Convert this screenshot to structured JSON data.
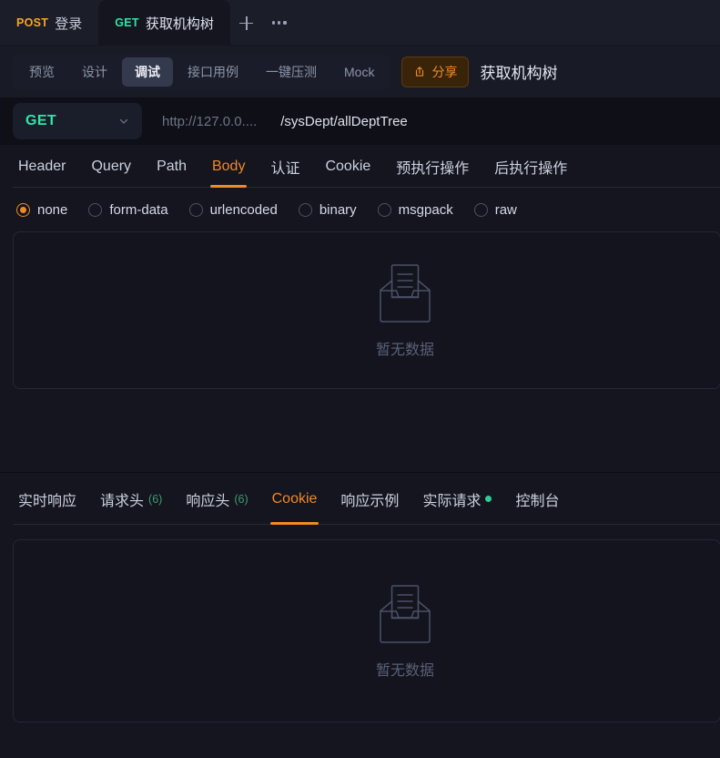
{
  "window_tabs": [
    {
      "verb": "POST",
      "verb_class": "post",
      "label": "登录",
      "active": false
    },
    {
      "verb": "GET",
      "verb_class": "get",
      "label": "获取机构树",
      "active": true
    }
  ],
  "window_actions": {
    "new_tab_icon": "plus-icon",
    "more_icon": "ellipsis-icon"
  },
  "toolbar": {
    "segments": [
      {
        "label": "预览",
        "active": false
      },
      {
        "label": "设计",
        "active": false
      },
      {
        "label": "调试",
        "active": true
      },
      {
        "label": "接口用例",
        "active": false
      },
      {
        "label": "一键压测",
        "active": false
      },
      {
        "label": "Mock",
        "active": false
      }
    ],
    "share_label": "分享",
    "share_icon": "share-export-icon",
    "request_title": "获取机构树"
  },
  "urlbar": {
    "method": "GET",
    "method_caret_icon": "chevron-down-icon",
    "host_placeholder": "http://127.0.0....",
    "path": "/sysDept/allDeptTree"
  },
  "request_tabs": [
    {
      "label": "Header",
      "active": false
    },
    {
      "label": "Query",
      "active": false
    },
    {
      "label": "Path",
      "active": false
    },
    {
      "label": "Body",
      "active": true
    },
    {
      "label": "认证",
      "active": false
    },
    {
      "label": "Cookie",
      "active": false
    },
    {
      "label": "预执行操作",
      "active": false
    },
    {
      "label": "后执行操作",
      "active": false
    }
  ],
  "body_types": [
    {
      "label": "none",
      "selected": true
    },
    {
      "label": "form-data",
      "selected": false
    },
    {
      "label": "urlencoded",
      "selected": false
    },
    {
      "label": "binary",
      "selected": false
    },
    {
      "label": "msgpack",
      "selected": false
    },
    {
      "label": "raw",
      "selected": false
    }
  ],
  "body_empty": {
    "caption": "暂无数据",
    "icon": "empty-inbox-icon"
  },
  "response_tabs": [
    {
      "label": "实时响应",
      "count": "",
      "dot": false,
      "active": false
    },
    {
      "label": "请求头",
      "count": "(6)",
      "dot": false,
      "active": false
    },
    {
      "label": "响应头",
      "count": "(6)",
      "dot": false,
      "active": false
    },
    {
      "label": "Cookie",
      "count": "",
      "dot": false,
      "active": true
    },
    {
      "label": "响应示例",
      "count": "",
      "dot": false,
      "active": false
    },
    {
      "label": "实际请求",
      "count": "",
      "dot": true,
      "active": false
    },
    {
      "label": "控制台",
      "count": "",
      "dot": false,
      "active": false
    }
  ],
  "response_empty": {
    "caption": "暂无数据",
    "icon": "empty-inbox-icon"
  },
  "colors": {
    "accent": "#f08a24",
    "get_green": "#2ee6a8",
    "post_orange": "#f5a524",
    "bg": "#14151f",
    "status_dot": "#2ecc9a"
  }
}
